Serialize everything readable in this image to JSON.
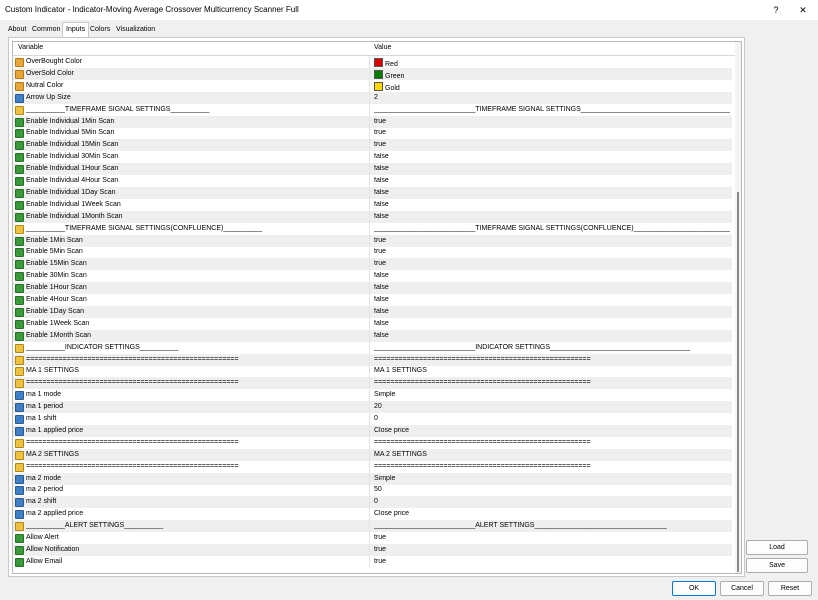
{
  "window": {
    "title": "Custom Indicator - Indicator-Moving Average Crossover Multicurrency Scanner Full",
    "help": "?",
    "close": "✕"
  },
  "tabs": [
    "About",
    "Common",
    "Inputs",
    "Colors",
    "Visualization"
  ],
  "active_tab": "Inputs",
  "grid": {
    "header": {
      "variable": "Variable",
      "value": "Value"
    },
    "rows": [
      {
        "t": "color",
        "v": "OverBought Color",
        "val": "Red",
        "sw": "#e00000"
      },
      {
        "t": "color",
        "v": "OverSold Color",
        "val": "Green",
        "sw": "#008000"
      },
      {
        "t": "color",
        "v": "Nutral Color",
        "val": "Gold",
        "sw": "#ffd700"
      },
      {
        "t": "num",
        "v": "Arrow Up Size",
        "val": "2"
      },
      {
        "t": "str",
        "v": "__________TIMEFRAME SIGNAL SETTINGS__________",
        "val": "__________________________TIMEFRAME SIGNAL SETTINGS________________________________________"
      },
      {
        "t": "bool",
        "v": "Enable Individual 1Min Scan",
        "val": "true"
      },
      {
        "t": "bool",
        "v": "Enable Individual 5Min Scan",
        "val": "true"
      },
      {
        "t": "bool",
        "v": "Enable Individual 15Min Scan",
        "val": "true"
      },
      {
        "t": "bool",
        "v": "Enable Individual 30Min Scan",
        "val": "false"
      },
      {
        "t": "bool",
        "v": "Enable Individual 1Hour Scan",
        "val": "false"
      },
      {
        "t": "bool",
        "v": "Enable Individual 4Hour Scan",
        "val": "false"
      },
      {
        "t": "bool",
        "v": "Enable Individual 1Day Scan",
        "val": "false"
      },
      {
        "t": "bool",
        "v": "Enable Individual 1Week Scan",
        "val": "false"
      },
      {
        "t": "bool",
        "v": "Enable Individual 1Month Scan",
        "val": "false"
      },
      {
        "t": "str",
        "v": "__________TIMEFRAME SIGNAL SETTINGS(CONFLUENCE)__________",
        "val": "__________________________TIMEFRAME SIGNAL SETTINGS(CONFLUENCE)______________________________..."
      },
      {
        "t": "bool",
        "v": "Enable 1Min Scan",
        "val": "true"
      },
      {
        "t": "bool",
        "v": "Enable 5Min Scan",
        "val": "true"
      },
      {
        "t": "bool",
        "v": "Enable 15Min Scan",
        "val": "true"
      },
      {
        "t": "bool",
        "v": "Enable 30Min Scan",
        "val": "false"
      },
      {
        "t": "bool",
        "v": "Enable 1Hour Scan",
        "val": "false"
      },
      {
        "t": "bool",
        "v": "Enable 4Hour Scan",
        "val": "false"
      },
      {
        "t": "bool",
        "v": "Enable 1Day Scan",
        "val": "false"
      },
      {
        "t": "bool",
        "v": "Enable 1Week Scan",
        "val": "false"
      },
      {
        "t": "bool",
        "v": "Enable 1Month Scan",
        "val": "false"
      },
      {
        "t": "str",
        "v": "__________INDICATOR SETTINGS__________",
        "val": "__________________________INDICATOR SETTINGS____________________________________"
      },
      {
        "t": "str",
        "v": "====================================================",
        "val": "====================================================="
      },
      {
        "t": "str",
        "v": "MA 1 SETTINGS",
        "val": "MA 1 SETTINGS"
      },
      {
        "t": "str",
        "v": "====================================================",
        "val": "====================================================="
      },
      {
        "t": "enum",
        "v": "ma 1 mode",
        "val": "Simple"
      },
      {
        "t": "num",
        "v": "ma 1 period",
        "val": "20"
      },
      {
        "t": "num",
        "v": "ma 1 shift",
        "val": "0"
      },
      {
        "t": "enum",
        "v": "ma 1 applied price",
        "val": "Close price"
      },
      {
        "t": "str",
        "v": "====================================================",
        "val": "====================================================="
      },
      {
        "t": "str",
        "v": "MA 2 SETTINGS",
        "val": "MA 2 SETTINGS"
      },
      {
        "t": "str",
        "v": "====================================================",
        "val": "====================================================="
      },
      {
        "t": "enum",
        "v": "ma 2 mode",
        "val": "Simple"
      },
      {
        "t": "num",
        "v": "ma 2 period",
        "val": "50"
      },
      {
        "t": "num",
        "v": "ma 2 shift",
        "val": "0"
      },
      {
        "t": "enum",
        "v": "ma 2 applied price",
        "val": "Close price"
      },
      {
        "t": "str",
        "v": "__________ALERT SETTINGS__________",
        "val": "__________________________ALERT SETTINGS__________________________________"
      },
      {
        "t": "bool",
        "v": "Allow Alert",
        "val": "true"
      },
      {
        "t": "bool",
        "v": "Allow Notification",
        "val": "true"
      },
      {
        "t": "bool",
        "v": "Allow Email",
        "val": "true"
      }
    ]
  },
  "side_buttons": {
    "load": "Load",
    "save": "Save"
  },
  "bottom_buttons": {
    "ok": "OK",
    "cancel": "Cancel",
    "reset": "Reset"
  }
}
